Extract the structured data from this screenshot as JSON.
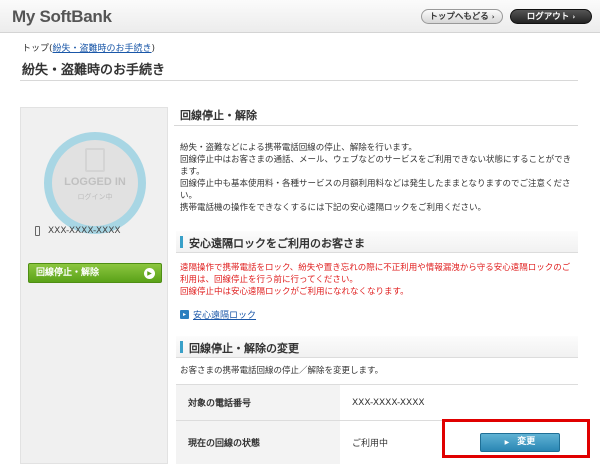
{
  "header": {
    "logo": "My SoftBank",
    "top_button": "トップへもどる",
    "logout_button": "ログアウト",
    "arrow": "›"
  },
  "breadcrumb": {
    "home": "トップ",
    "open_paren": "(",
    "current": "紛失・盗難時のお手続き",
    "close_paren": ")"
  },
  "page_title": "紛失・盗難時のお手続き",
  "sidebar": {
    "login_title": "LOGGED IN",
    "login_sub": "ログイン中",
    "phone_number": "XXX-XXXX-XXXX",
    "nav_button": "回線停止・解除",
    "nav_arrow": "▶"
  },
  "sections": {
    "suspend": {
      "title": "回線停止・解除",
      "lines": [
        "紛失・盗難などによる携帯電話回線の停止、解除を行います。",
        "回線停止中はお客さまの通話、メール、ウェブなどのサービスをご利用できない状態にすることができます。",
        "回線停止中も基本使用料・各種サービスの月額利用料などは発生したままとなりますのでご注意ください。",
        "携帯電話機の操作をできなくするには下記の安心遠隔ロックをご利用ください。"
      ]
    },
    "remote_lock": {
      "title": "安心遠隔ロックをご利用のお客さま",
      "red_lines": [
        "遠隔操作で携帯電話をロック、紛失や置き忘れの際に不正利用や情報漏洩から守る安心遠隔ロックのご利用は、回線停止を行う前に行ってください。",
        "回線停止中は安心遠隔ロックがご利用になれなくなります。"
      ],
      "link_icon": "▸",
      "link": "安心遠隔ロック"
    },
    "change": {
      "title": "回線停止・解除の変更",
      "description": "お客さまの携帯電話回線の停止／解除を変更します。",
      "rows": [
        {
          "label": "対象の電話番号",
          "value": "XXX-XXXX-XXXX"
        },
        {
          "label": "現在の回線の状態",
          "value": "ご利用中"
        }
      ],
      "change_button": "変更",
      "button_arrow": "▶"
    }
  }
}
